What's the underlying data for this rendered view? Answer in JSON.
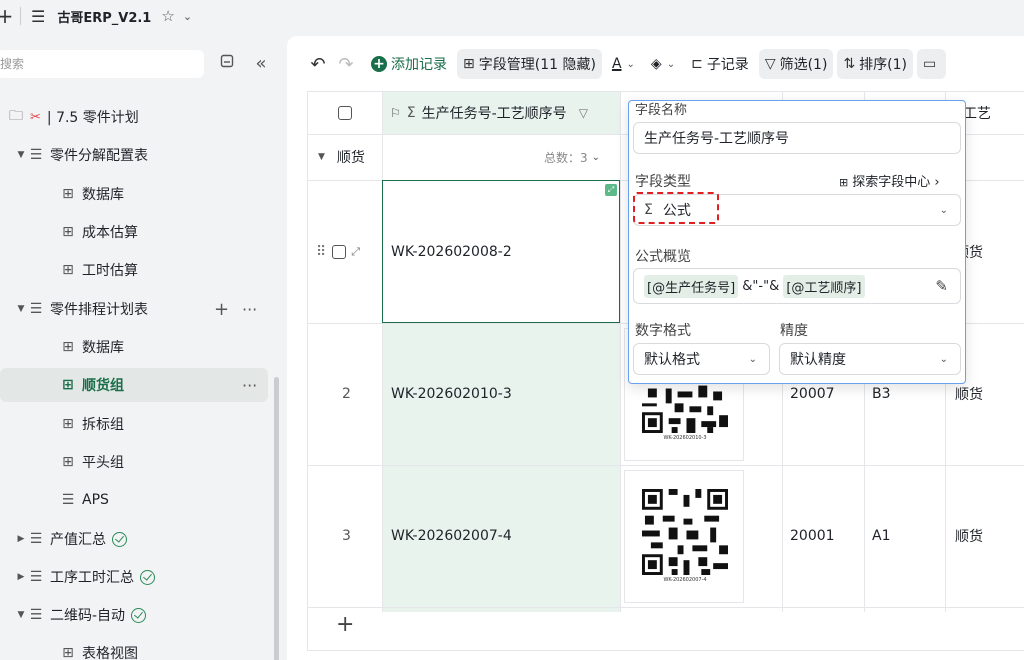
{
  "topbar": {
    "plus": "+",
    "menu": "☰",
    "title": "古哥ERP_V2.1",
    "star": "☆",
    "caret": "⌄"
  },
  "sidebar": {
    "search_placeholder": "搜索",
    "tree": {
      "root": "| 7.5 零件计划",
      "g1": "零件分解配置表",
      "g1_a": "数据库",
      "g1_b": "成本估算",
      "g1_c": "工时估算",
      "g2": "零件排程计划表",
      "g2_a": "数据库",
      "g2_b": "顺货组",
      "g2_c": "拆标组",
      "g2_d": "平头组",
      "g2_e": "APS",
      "g3": "产值汇总",
      "g4": "工序工时汇总",
      "g5": "二维码-自动",
      "g5_a": "表格视图"
    }
  },
  "toolbar": {
    "add_record": "添加记录",
    "field_mgmt": "字段管理(11 隐藏)",
    "text_color": "A",
    "sub_record": "子记录",
    "filter": "筛选(1)",
    "sort": "排序(1)"
  },
  "grid": {
    "header_field": "生产任务号-工艺顺序号",
    "header_right": "件工艺",
    "group_name": "顺货",
    "group_total": "总数：3",
    "add_row": "+",
    "rows": [
      {
        "num": "",
        "task": "WK-202602008-2",
        "c3": "",
        "c4": "",
        "c5": "顺货",
        "qr": ""
      },
      {
        "num": "2",
        "task": "WK-202602010-3",
        "c3": "20007",
        "c4": "B3",
        "c5": "顺货",
        "qr": "WK-202602010-3"
      },
      {
        "num": "3",
        "task": "WK-202602007-4",
        "c3": "20001",
        "c4": "A1",
        "c5": "顺货",
        "qr": "WK-202602007-4"
      }
    ]
  },
  "popup": {
    "field_name_label": "字段名称",
    "field_name_value": "生产任务号-工艺顺序号",
    "field_type_label": "字段类型",
    "explore_link": "探索字段中心 ›",
    "field_type_value": "公式",
    "formula_label": "公式概览",
    "formula_tag1": "[@生产任务号]",
    "formula_mid": " &\"-\"& ",
    "formula_tag2": "[@工艺顺序]",
    "number_format_label": "数字格式",
    "number_format_value": "默认格式",
    "precision_label": "精度",
    "precision_value": "默认精度"
  }
}
